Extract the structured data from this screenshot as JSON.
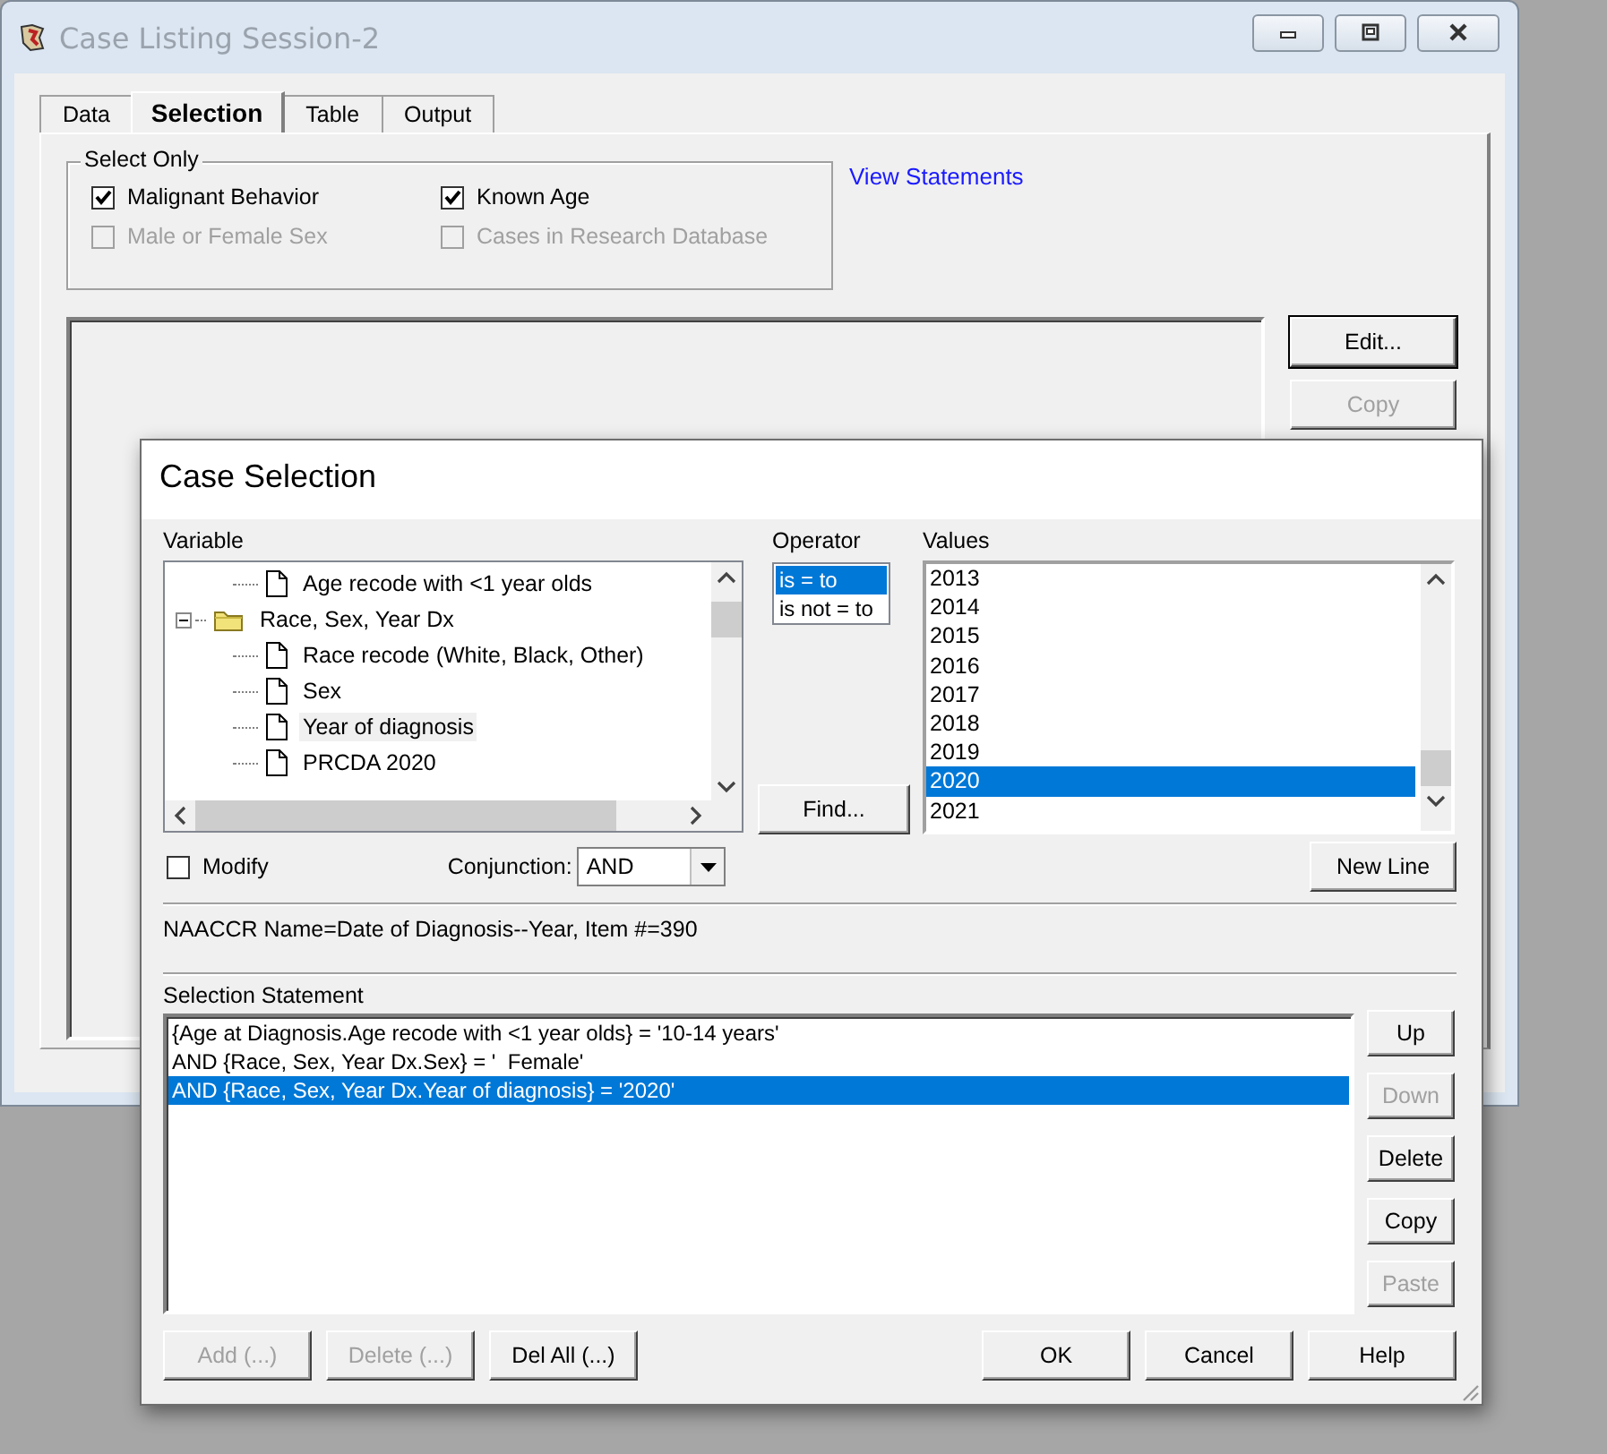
{
  "main_window": {
    "title": "Case Listing Session-2",
    "tabs": [
      {
        "label": "Data",
        "selected": false
      },
      {
        "label": "Selection",
        "selected": true
      },
      {
        "label": "Table",
        "selected": false
      },
      {
        "label": "Output",
        "selected": false
      }
    ],
    "select_only": {
      "title": "Select Only",
      "options": [
        {
          "label": "Malignant Behavior",
          "checked": true,
          "disabled": false
        },
        {
          "label": "Known Age",
          "checked": true,
          "disabled": false
        },
        {
          "label": "Male or Female Sex",
          "checked": false,
          "disabled": true
        },
        {
          "label": "Cases in Research Database",
          "checked": false,
          "disabled": true
        }
      ]
    },
    "link": "View Statements",
    "buttons": [
      {
        "label": "Edit...",
        "disabled": false
      },
      {
        "label": "Copy",
        "disabled": true
      }
    ]
  },
  "dialog": {
    "title": "Case Selection",
    "variable": {
      "label": "Variable",
      "tree": [
        {
          "children": [
            {
              "label": "Age recode with <1 year olds",
              "selected": false
            }
          ]
        },
        {
          "label": "Race, Sex, Year Dx",
          "expanded": true,
          "selected": false,
          "children": [
            {
              "label": "Race recode (White, Black, Other)",
              "selected": false
            },
            {
              "label": "Sex",
              "selected": false
            },
            {
              "label": "Year of diagnosis",
              "selected": true
            },
            {
              "label": "PRCDA 2020",
              "selected": false
            }
          ]
        }
      ]
    },
    "operator": {
      "label": "Operator",
      "items": [
        {
          "label": "is = to",
          "selected": true
        },
        {
          "label": "is not = to",
          "selected": false
        }
      ]
    },
    "values": {
      "label": "Values",
      "items": [
        {
          "label": "2013",
          "selected": false
        },
        {
          "label": "2014",
          "selected": false
        },
        {
          "label": "2015",
          "selected": false
        },
        {
          "label": "2016",
          "selected": false
        },
        {
          "label": "2017",
          "selected": false
        },
        {
          "label": "2018",
          "selected": false
        },
        {
          "label": "2019",
          "selected": false
        },
        {
          "label": "2020",
          "selected": true
        },
        {
          "label": "2021",
          "selected": false
        }
      ]
    },
    "find_button": "Find...",
    "modify": {
      "label": "Modify",
      "checked": false
    },
    "conjunction": {
      "label": "Conjunction:",
      "value": "AND"
    },
    "new_line_button": "New Line",
    "info": "NAACCR Name=Date of Diagnosis--Year, Item #=390",
    "statement": {
      "label": "Selection Statement",
      "lines": [
        {
          "text": "{Age at Diagnosis.Age recode with <1 year olds} = '10-14 years'",
          "selected": false
        },
        {
          "text": "AND {Race, Sex, Year Dx.Sex} = '  Female'",
          "selected": false
        },
        {
          "text": "AND {Race, Sex, Year Dx.Year of diagnosis} = '2020'",
          "selected": true
        }
      ],
      "buttons": [
        {
          "label": "Up",
          "disabled": false
        },
        {
          "label": "Down",
          "disabled": true
        },
        {
          "label": "Delete",
          "disabled": false
        },
        {
          "label": "Copy",
          "disabled": false
        },
        {
          "label": "Paste",
          "disabled": true
        }
      ]
    },
    "bottom_left_buttons": [
      {
        "label": "Add (...)",
        "disabled": true
      },
      {
        "label": "Delete (...)",
        "disabled": true
      },
      {
        "label": "Del All (...)",
        "disabled": false
      }
    ],
    "bottom_right_buttons": [
      {
        "label": "OK",
        "disabled": false
      },
      {
        "label": "Cancel",
        "disabled": false
      },
      {
        "label": "Help",
        "disabled": false
      }
    ]
  }
}
